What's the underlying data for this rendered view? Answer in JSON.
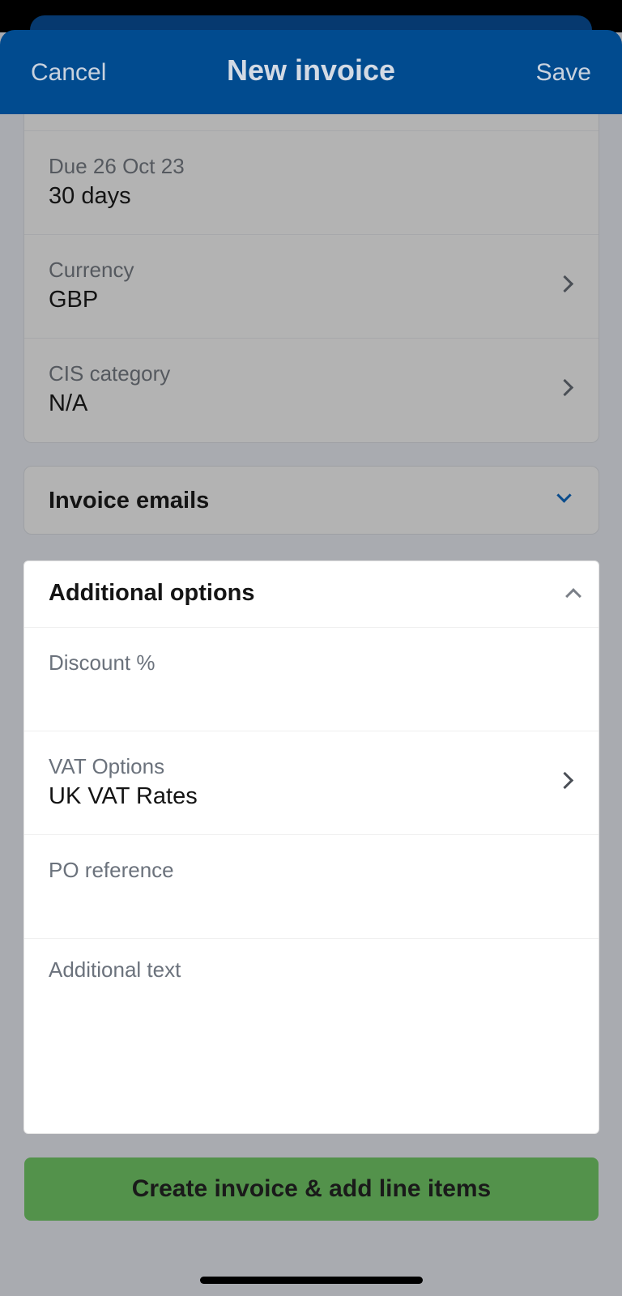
{
  "nav": {
    "cancel_label": "Cancel",
    "title": "New invoice",
    "save_label": "Save"
  },
  "details": {
    "due": {
      "label": "Due 26 Oct 23",
      "value": "30 days"
    },
    "currency": {
      "label": "Currency",
      "value": "GBP"
    },
    "cis": {
      "label": "CIS category",
      "value": "N/A"
    }
  },
  "invoice_emails": {
    "title": "Invoice emails",
    "expanded": false
  },
  "additional_options": {
    "title": "Additional options",
    "expanded": true,
    "discount": {
      "label": "Discount %",
      "value": ""
    },
    "vat": {
      "label": "VAT Options",
      "value": "UK VAT Rates"
    },
    "po_reference": {
      "label": "PO reference",
      "value": ""
    },
    "additional_text": {
      "label": "Additional text",
      "value": ""
    }
  },
  "create_button_label": "Create invoice & add line items",
  "colors": {
    "nav_background": "#014b8f",
    "primary_button": "#53924b",
    "overlay_dim": "#a9abb0"
  }
}
